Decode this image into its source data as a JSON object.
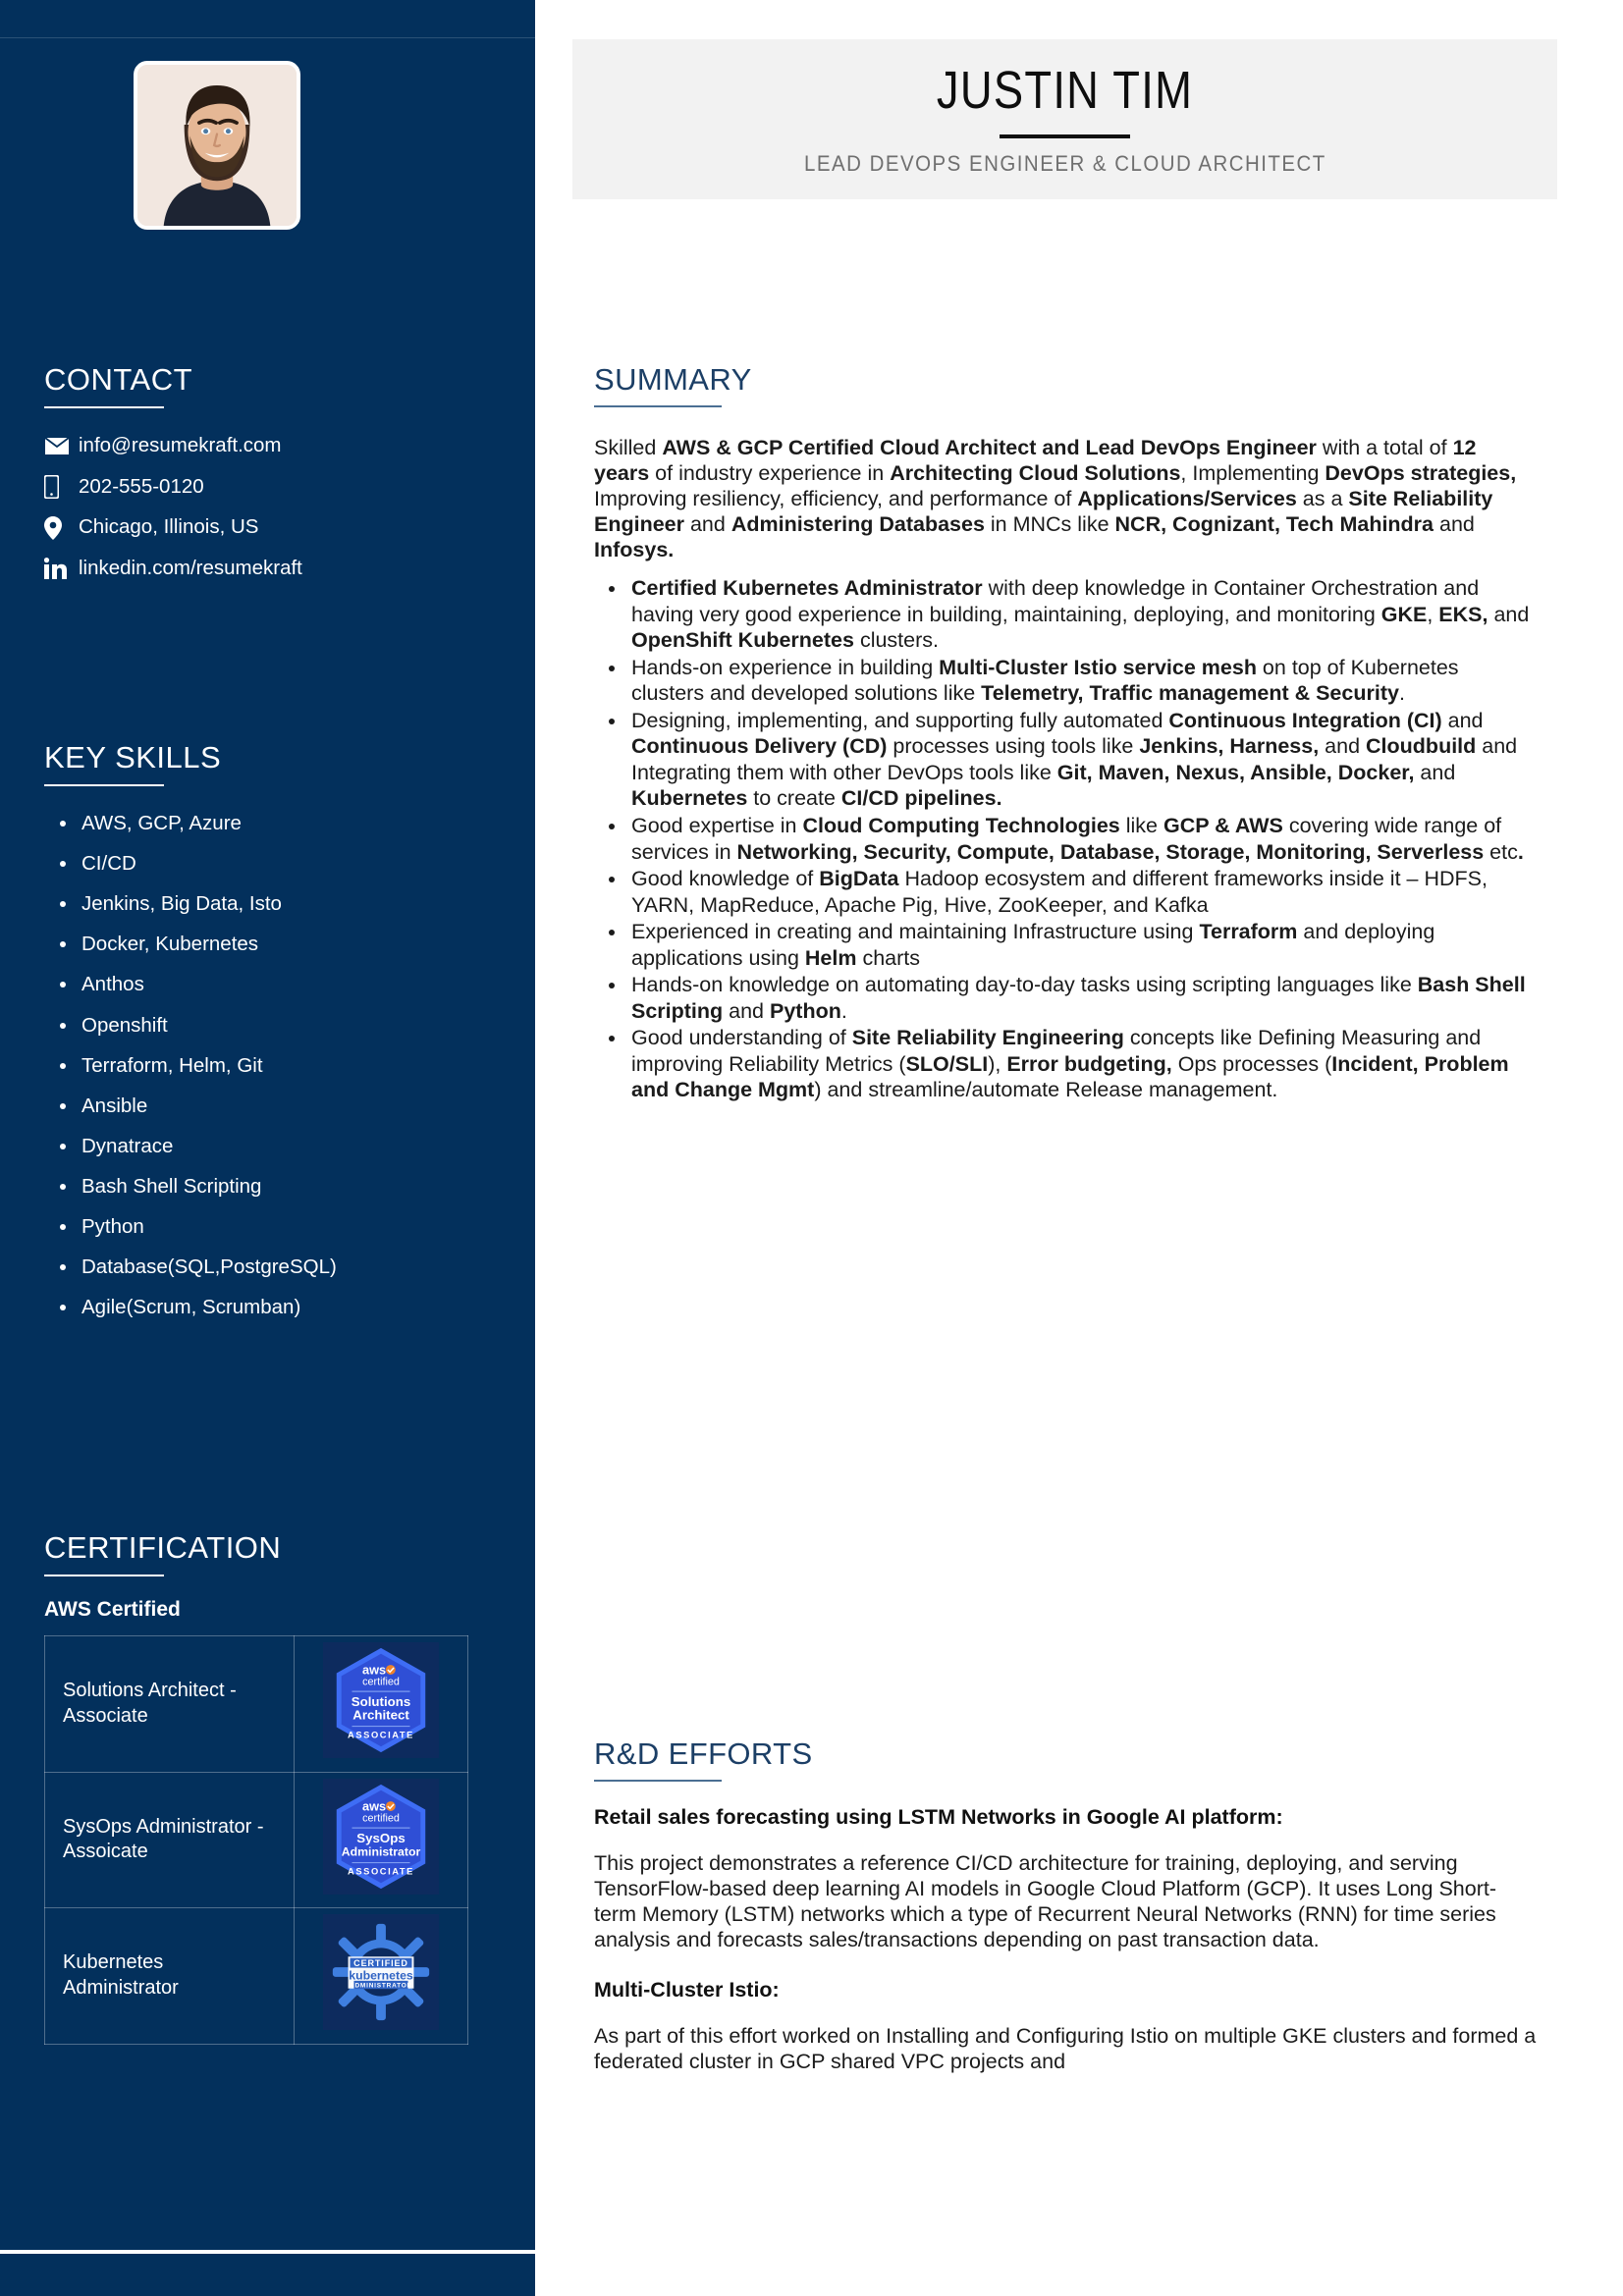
{
  "header": {
    "name": "JUSTIN TIM",
    "role": "LEAD DEVOPS ENGINEER & CLOUD ARCHITECT"
  },
  "colors": {
    "sidebar_bg": "#03305c",
    "header_band_bg": "#f2f2f2",
    "section_heading": "#1c3f66",
    "body_text": "#1b1b1b",
    "sidebar_text": "#ffffff"
  },
  "sidebar": {
    "contact": {
      "heading": "CONTACT",
      "items": [
        {
          "icon": "envelope-icon",
          "label": "info@resumekraft.com"
        },
        {
          "icon": "mobile-phone-icon",
          "label": "202-555-0120"
        },
        {
          "icon": "map-pin-icon",
          "label": "Chicago, Illinois, US"
        },
        {
          "icon": "linkedin-icon",
          "label": "linkedin.com/resumekraft"
        }
      ]
    },
    "key_skills": {
      "heading": "KEY SKILLS",
      "items": [
        "AWS, GCP, Azure",
        "CI/CD",
        "Jenkins, Big Data, Isto",
        "Docker, Kubernetes",
        "Anthos",
        "Openshift",
        "Terraform, Helm, Git",
        "Ansible",
        "Dynatrace",
        "Bash Shell Scripting",
        "Python",
        "Database(SQL,PostgreSQL)",
        "Agile(Scrum, Scrumban)"
      ]
    },
    "certification": {
      "heading": "CERTIFICATION",
      "subheading": "AWS Certified",
      "rows": [
        {
          "title": "Solutions Architect - Associate",
          "badge": {
            "icon": "aws-certified-badge",
            "brand": "aws",
            "brand_sub": "certified",
            "line1": "Solutions",
            "line2": "Architect",
            "level": "ASSOCIATE"
          }
        },
        {
          "title": "SysOps Administrator - Assoicate",
          "badge": {
            "icon": "aws-certified-badge",
            "brand": "aws",
            "brand_sub": "certified",
            "line1": "SysOps",
            "line2": "Administrator",
            "level": "ASSOCIATE"
          }
        },
        {
          "title": "Kubernetes Administrator",
          "badge": {
            "icon": "certified-kubernetes-administrator-badge",
            "line1": "CERTIFIED",
            "line2": "kubernetes",
            "level": "ADMINISTRATOR"
          }
        }
      ]
    }
  },
  "main": {
    "summary": {
      "heading": "SUMMARY",
      "paragraph_html": "Skilled <b>AWS &amp; GCP Certified Cloud Architect and Lead DevOps Engineer</b> with a total of <b>12 years</b> of industry experience in <b>Architecting Cloud Solutions</b>, Implementing <b>DevOps strategies,</b> Improving resiliency, efficiency, and performance of <b>Applications/Services</b> as a <b>Site Reliability Engineer</b> and <b>Administering Databases</b> in MNCs like <b>NCR, Cognizant, Tech Mahindra</b> and <b>Infosys.</b>",
      "bullets_html": [
        "<b>Certified Kubernetes Administrator</b> with deep knowledge in Container Orchestration and having very good experience in building, maintaining, deploying, and monitoring <b>GKE</b>, <b>EKS,</b> and <b>OpenShift Kubernetes</b> clusters.",
        "Hands-on experience in building <b>Multi-Cluster Istio service mesh</b> on top of Kubernetes clusters and developed solutions like <b>Telemetry, Traffic management &amp; Security</b>.",
        "Designing, implementing, and supporting fully automated <b>Continuous Integration (CI)</b> and <b>Continuous Delivery (CD)</b> processes using tools like <b>Jenkins, Harness,</b> and <b>Cloudbuild</b> and Integrating them with other DevOps tools like <b>Git, Maven, Nexus, Ansible, Docker,</b> and <b>Kubernetes</b> to create <b>CI/CD pipelines.</b>",
        "Good expertise in <b>Cloud Computing Technologies</b> like <b>GCP &amp; AWS</b> covering wide range of services in <b>Networking, Security, Compute, Database, Storage, Monitoring, Serverless</b> etc<b>.</b>",
        "Good knowledge of <b>BigData</b> Hadoop ecosystem and different frameworks inside it – HDFS, YARN, MapReduce, Apache Pig, Hive, ZooKeeper, and Kafka",
        "Experienced in creating and maintaining Infrastructure using <b>Terraform</b> and deploying applications using <b>Helm</b> charts",
        "Hands-on knowledge on automating day-to-day tasks using scripting languages like <b>Bash Shell Scripting</b> and <b>Python</b>.",
        "Good understanding of <b>Site Reliability Engineering</b> concepts like Defining Measuring and improving Reliability Metrics (<b>SLO/SLI</b>), <b>Error budgeting,</b> Ops processes (<b>Incident, Problem and Change Mgmt</b>) and streamline/automate Release management."
      ]
    },
    "rnd": {
      "heading": "R&D EFFORTS",
      "items": [
        {
          "title": "Retail sales forecasting using LSTM Networks in Google AI platform:",
          "body": "This project demonstrates a reference CI/CD architecture for training, deploying, and serving TensorFlow-based deep learning AI models in Google Cloud Platform (GCP). It uses Long Short-term Memory (LSTM) networks which a type of Recurrent Neural Networks (RNN) for time series analysis and forecasts sales/transactions depending on past transaction data."
        },
        {
          "title": "Multi-Cluster Istio:",
          "body": "As part of this effort worked on Installing and Configuring Istio on multiple GKE clusters and formed a federated cluster in GCP shared VPC projects and"
        }
      ]
    }
  }
}
